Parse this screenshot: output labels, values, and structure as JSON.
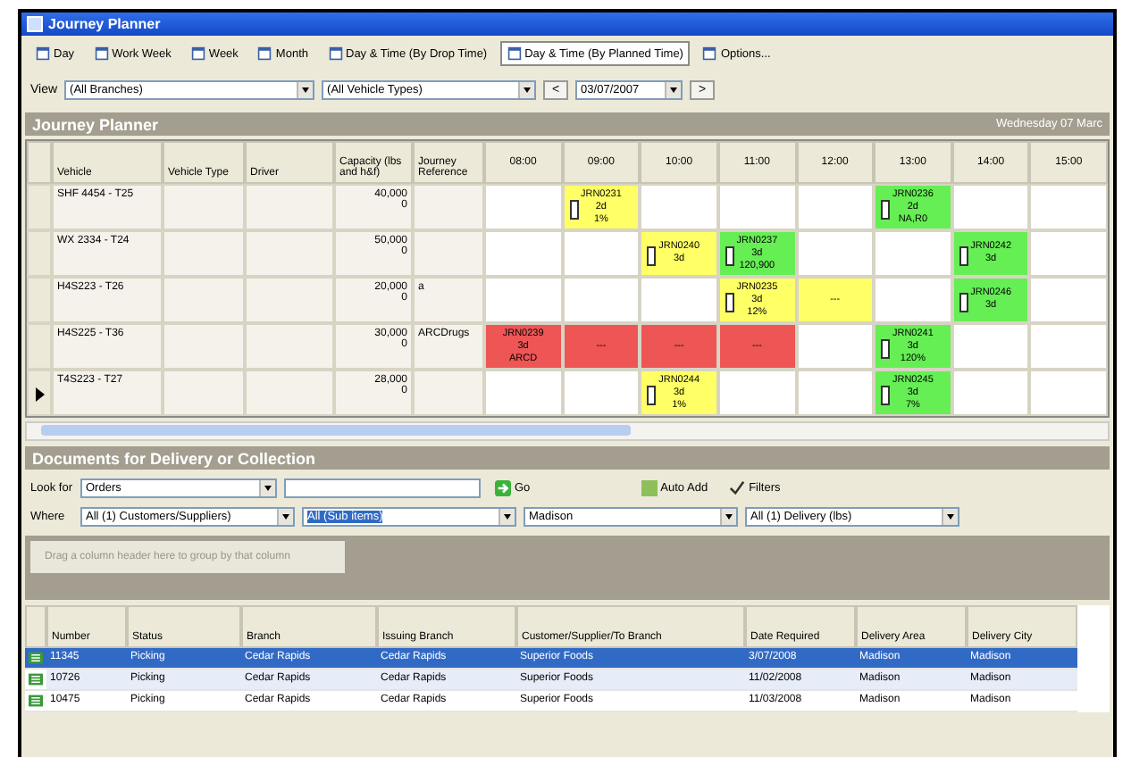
{
  "window": {
    "title": "Journey Planner"
  },
  "toolbar": [
    {
      "label": "Day",
      "selected": false
    },
    {
      "label": "Work Week",
      "selected": false
    },
    {
      "label": "Week",
      "selected": false
    },
    {
      "label": "Month",
      "selected": false
    },
    {
      "label": "Day & Time (By Drop Time)",
      "selected": false
    },
    {
      "label": "Day & Time (By Planned Time)",
      "selected": true
    },
    {
      "label": "Options...",
      "selected": false
    }
  ],
  "view": {
    "label": "View",
    "depot": "(All Branches)",
    "vehicle_type": "(All Vehicle Types)",
    "prev": "<",
    "date": "03/07/2007",
    "next": ">"
  },
  "planner": {
    "title": "Journey Planner",
    "date": "Wednesday 07 Marc",
    "columns": [
      "Vehicle",
      "Vehicle Type",
      "Driver",
      "Capacity (lbs and h&f)",
      "Journey Reference"
    ],
    "times": [
      "08:00",
      "09:00",
      "10:00",
      "11:00",
      "12:00",
      "13:00",
      "14:00",
      "15:00"
    ],
    "rows": [
      {
        "vehicle": "SHF 4454 - T25",
        "type": "",
        "driver": "",
        "capacity": [
          "40,000",
          "0"
        ],
        "reference": "",
        "current": false,
        "slots": [
          {
            "kind": "empty"
          },
          {
            "kind": "booking",
            "color": "#ffff66",
            "lines": [
              "JRN0231",
              "2d",
              "1%"
            ]
          },
          {
            "kind": "empty"
          },
          {
            "kind": "empty"
          },
          {
            "kind": "empty"
          },
          {
            "kind": "booking",
            "color": "#66ee55",
            "lines": [
              "JRN0236",
              "2d",
              "NA,R0"
            ]
          },
          {
            "kind": "empty"
          },
          {
            "kind": "empty"
          }
        ]
      },
      {
        "vehicle": "WX 2334 - T24",
        "type": "",
        "driver": "",
        "capacity": [
          "50,000",
          "0"
        ],
        "reference": "",
        "current": false,
        "slots": [
          {
            "kind": "empty"
          },
          {
            "kind": "empty"
          },
          {
            "kind": "booking",
            "color": "#ffff66",
            "lines": [
              "JRN0240",
              "3d"
            ]
          },
          {
            "kind": "booking",
            "color": "#66ee55",
            "lines": [
              "JRN0237",
              "3d",
              "120,900"
            ]
          },
          {
            "kind": "empty"
          },
          {
            "kind": "empty"
          },
          {
            "kind": "booking",
            "color": "#66ee55",
            "lines": [
              "JRN0242",
              "3d"
            ]
          },
          {
            "kind": "empty"
          }
        ]
      },
      {
        "vehicle": "H4S223 - T26",
        "type": "",
        "driver": "",
        "capacity": [
          "20,000",
          "0"
        ],
        "reference": "a",
        "current": false,
        "slots": [
          {
            "kind": "empty"
          },
          {
            "kind": "empty"
          },
          {
            "kind": "empty"
          },
          {
            "kind": "booking",
            "color": "#ffff66",
            "lines": [
              "JRN0235",
              "3d",
              "12%"
            ]
          },
          {
            "kind": "continuation",
            "color": "#ffff66",
            "lines": [
              "---"
            ]
          },
          {
            "kind": "empty"
          },
          {
            "kind": "booking",
            "color": "#66ee55",
            "lines": [
              "JRN0246",
              "3d"
            ]
          },
          {
            "kind": "empty"
          }
        ]
      },
      {
        "vehicle": "H4S225 - T36",
        "type": "",
        "driver": "",
        "capacity": [
          "30,000",
          "0"
        ],
        "reference": "ARCDrugs",
        "current": false,
        "slots": [
          {
            "kind": "start",
            "color": "#ee5555",
            "lines": [
              "JRN0239",
              "3d",
              "ARCD"
            ]
          },
          {
            "kind": "continuation",
            "color": "#ee5555",
            "lines": [
              "---"
            ]
          },
          {
            "kind": "continuation",
            "color": "#ee5555",
            "lines": [
              "---"
            ]
          },
          {
            "kind": "continuation",
            "color": "#ee5555",
            "lines": [
              "---"
            ]
          },
          {
            "kind": "empty"
          },
          {
            "kind": "booking",
            "color": "#66ee55",
            "lines": [
              "JRN0241",
              "3d",
              "120%"
            ]
          },
          {
            "kind": "empty"
          },
          {
            "kind": "empty"
          }
        ]
      },
      {
        "vehicle": "T4S223 - T27",
        "type": "",
        "driver": "",
        "capacity": [
          "28,000",
          "0"
        ],
        "reference": "",
        "current": true,
        "slots": [
          {
            "kind": "empty"
          },
          {
            "kind": "empty"
          },
          {
            "kind": "booking",
            "color": "#ffff66",
            "lines": [
              "JRN0244",
              "3d",
              "1%"
            ]
          },
          {
            "kind": "empty"
          },
          {
            "kind": "empty"
          },
          {
            "kind": "booking",
            "color": "#66ee55",
            "lines": [
              "JRN0245",
              "3d",
              "7%"
            ]
          },
          {
            "kind": "empty"
          },
          {
            "kind": "empty"
          }
        ]
      }
    ]
  },
  "documents": {
    "title": "Documents for Delivery or Collection",
    "look_for": {
      "label": "Look for",
      "value": "Orders",
      "go": "Go",
      "auto_add": "Auto Add",
      "filters": "Filters"
    },
    "where": {
      "label": "Where",
      "fields": [
        {
          "value": "All (1) Customers/Suppliers)",
          "selected": false
        },
        {
          "value": "All (Sub items)",
          "selected": true
        },
        {
          "value": "Madison",
          "selected": false
        },
        {
          "value": "All (1) Delivery (lbs)",
          "selected": false
        }
      ]
    },
    "group_hint": "Drag a column header here to group by that column",
    "columns": [
      "Number",
      "Status",
      "Branch",
      "Issuing Branch",
      "Customer/Supplier/To Branch",
      "Date Required",
      "Delivery Area",
      "Delivery City"
    ],
    "rows": [
      {
        "selected": true,
        "cells": [
          "11345",
          "Picking",
          "Cedar Rapids",
          "Cedar Rapids",
          "Superior Foods",
          "3/07/2008",
          "Madison",
          "Madison"
        ]
      },
      {
        "selected": false,
        "cells": [
          "10726",
          "Picking",
          "Cedar Rapids",
          "Cedar Rapids",
          "Superior Foods",
          "11/02/2008",
          "Madison",
          "Madison"
        ]
      },
      {
        "selected": false,
        "cells": [
          "10475",
          "Picking",
          "Cedar Rapids",
          "Cedar Rapids",
          "Superior Foods",
          "11/03/2008",
          "Madison",
          "Madison"
        ]
      }
    ]
  }
}
